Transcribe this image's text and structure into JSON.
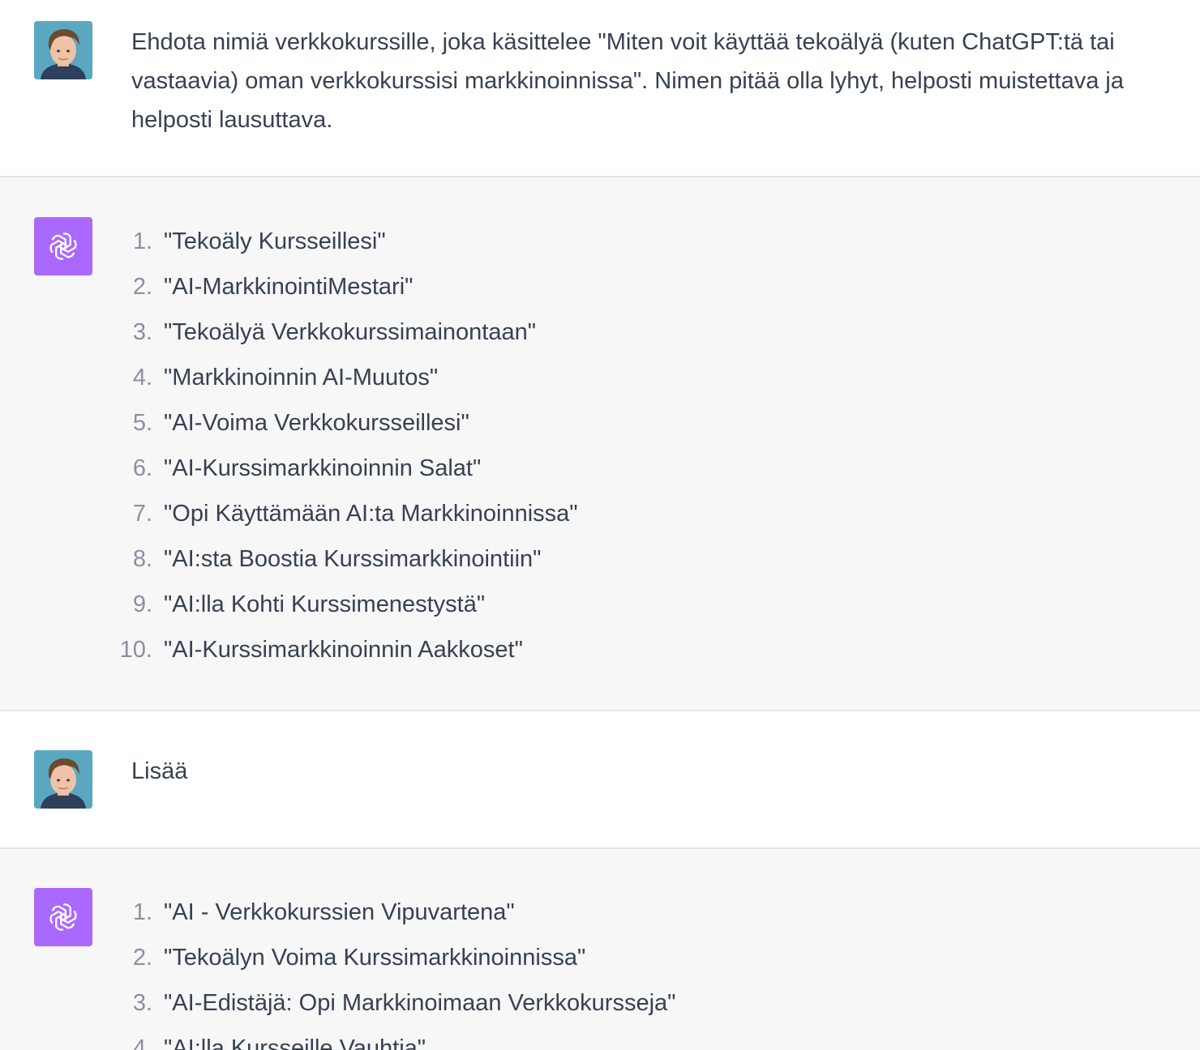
{
  "conversation": {
    "user_message_1": "Ehdota nimiä verkkokurssille, joka käsittelee \"Miten voit käyttää tekoälyä (kuten ChatGPT:tä tai vastaavia) oman verkkokurssisi markkinoinnissa\". Nimen pitää olla lyhyt, helposti muistettava ja helposti lausuttava.",
    "assistant_reply_1": [
      {
        "num": "1.",
        "text": "\"Tekoäly Kursseillesi\""
      },
      {
        "num": "2.",
        "text": "\"AI-MarkkinointiMestari\""
      },
      {
        "num": "3.",
        "text": "\"Tekoälyä Verkkokurssimainontaan\""
      },
      {
        "num": "4.",
        "text": "\"Markkinoinnin AI-Muutos\""
      },
      {
        "num": "5.",
        "text": "\"AI-Voima Verkkokursseillesi\""
      },
      {
        "num": "6.",
        "text": "\"AI-Kurssimarkkinoinnin Salat\""
      },
      {
        "num": "7.",
        "text": "\"Opi Käyttämään AI:ta Markkinoinnissa\""
      },
      {
        "num": "8.",
        "text": "\"AI:sta Boostia Kurssimarkkinointiin\""
      },
      {
        "num": "9.",
        "text": "\"AI:lla Kohti Kurssimenestystä\""
      },
      {
        "num": "10.",
        "text": "\"AI-Kurssimarkkinoinnin Aakkoset\""
      }
    ],
    "user_message_2": "Lisää",
    "assistant_reply_2": [
      {
        "num": "1.",
        "text": "\"AI - Verkkokurssien Vipuvartena\""
      },
      {
        "num": "2.",
        "text": "\"Tekoälyn Voima Kurssimarkkinoinnissa\""
      },
      {
        "num": "3.",
        "text": "\"AI-Edistäjä: Opi Markkinoimaan Verkkokursseja\""
      },
      {
        "num": "4.",
        "text": "\"AI:lla Kursseille Vauhtia\""
      }
    ]
  },
  "colors": {
    "assistant_bg": "#f7f7f8",
    "user_bg": "#ffffff",
    "bot_avatar": "#ab68ff",
    "text": "#374151",
    "list_number": "#8e8ea0"
  },
  "icons": {
    "user_avatar": "user-photo-avatar",
    "bot_avatar": "openai-logo-icon"
  }
}
